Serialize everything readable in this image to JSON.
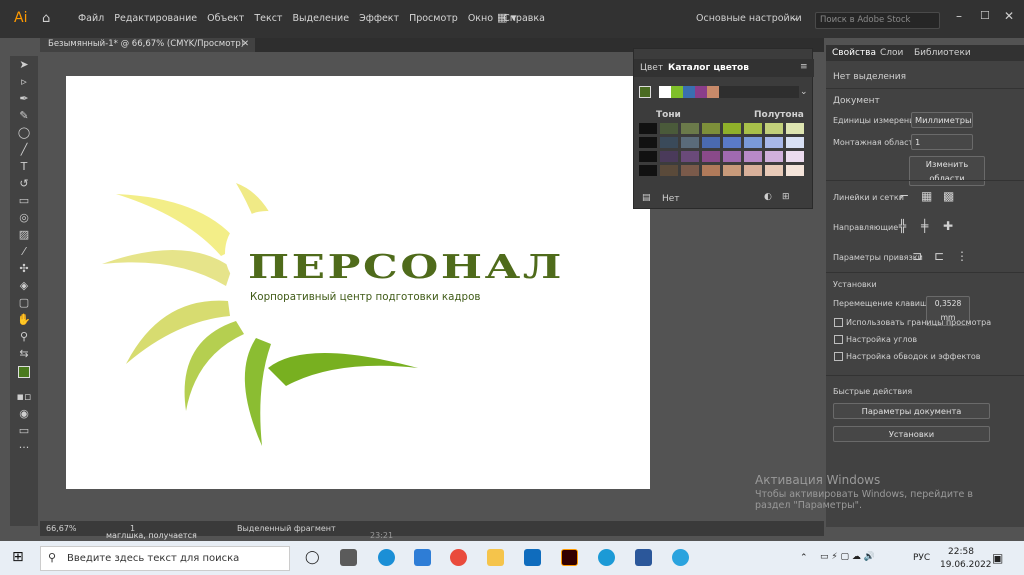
{
  "app": {
    "logo": "Ai",
    "menus": [
      "Файл",
      "Редактирование",
      "Объект",
      "Текст",
      "Выделение",
      "Эффект",
      "Просмотр",
      "Окно",
      "Справка"
    ],
    "workspace": "Основные настройки",
    "search_placeholder": "Поиск в Adobe Stock"
  },
  "document": {
    "tab_title": "Безымянный-1* @ 66,67% (CMYK/Просмотр)"
  },
  "artwork": {
    "title": "ПЕРСОНАЛ",
    "subtitle": "Корпоративный центр подготовки кадров"
  },
  "swatch_panel": {
    "tabs": [
      "Цвет",
      "Каталог цветов"
    ],
    "col_tones": "Тони",
    "col_halftones": "Полутона",
    "footer": "Нет"
  },
  "properties": {
    "tabs": [
      "Свойства",
      "Слои",
      "Библиотеки"
    ],
    "no_selection": "Нет выделения",
    "document_section": "Документ",
    "units_label": "Единицы измерения:",
    "units_value": "Миллиметры",
    "artboard_label": "Монтажная область:",
    "artboard_value": "1",
    "edit_artboards": "Изменить области",
    "rulers_grids": "Линейки и сетки",
    "guides": "Направляющие",
    "snap_options": "Параметры привязки",
    "prefs": "Установки",
    "keyboard_inc_label": "Перемещение клавишами:",
    "keyboard_inc_value": "0,3528 mm",
    "checks": [
      "Использовать границы просмотра",
      "Настройка углов",
      "Настройка обводок и эффектов"
    ],
    "quick_actions": "Быстрые действия",
    "doc_setup": "Параметры документа",
    "preferences_btn": "Установки"
  },
  "status": {
    "zoom": "66,67%",
    "artboard": "1",
    "tool": "Выделенный фрагмент"
  },
  "watermark": {
    "title": "Активация Windows",
    "line1": "Чтобы активировать Windows, перейдите в",
    "line2": "раздел \"Параметры\"."
  },
  "taskbar": {
    "search": "Введите здесь текст для поиска",
    "lang": "РУС",
    "time": "22:58",
    "date": "19.06.2022",
    "peek_text": "маглшка, получается",
    "peek_time": "23:21"
  },
  "colors": {
    "accent": "#ff9a00",
    "logo_green": "#4f6b1b"
  }
}
